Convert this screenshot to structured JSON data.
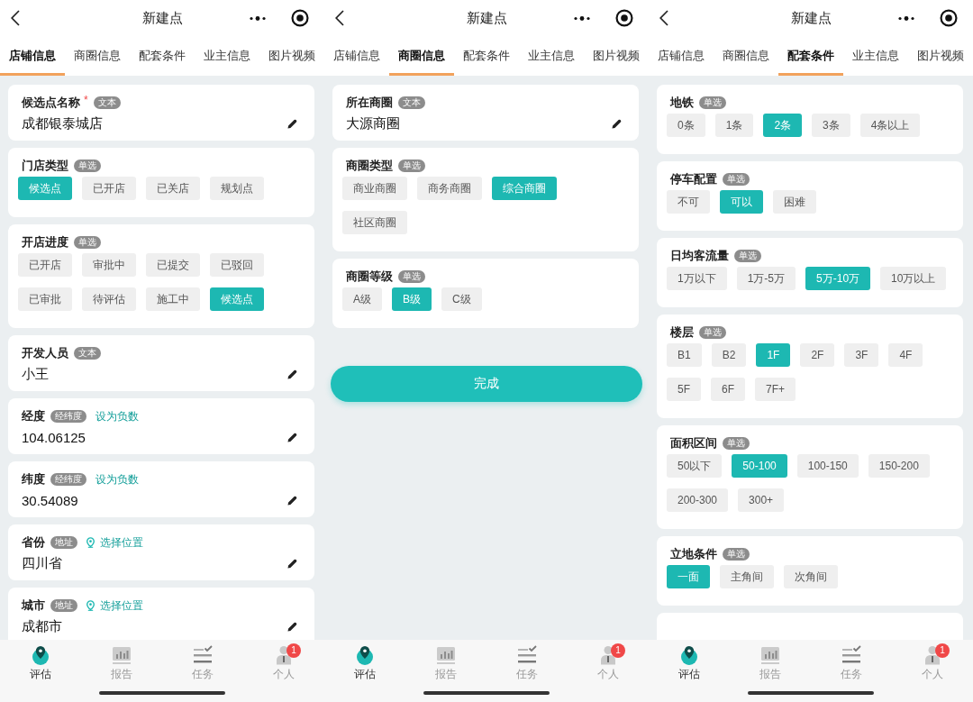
{
  "phones": [
    {
      "header": {
        "title": "新建点"
      },
      "tabs": [
        {
          "label": "店铺信息",
          "selected": true
        },
        {
          "label": "商圈信息",
          "selected": false
        },
        {
          "label": "配套条件",
          "selected": false
        },
        {
          "label": "业主信息",
          "selected": false
        },
        {
          "label": "图片视频",
          "selected": false
        }
      ],
      "sections": [
        {
          "kind": "text",
          "title": "候选点名称",
          "required_mark": "*",
          "tag": "文本",
          "value": "成都银泰城店"
        },
        {
          "kind": "choice",
          "title": "门店类型",
          "tag": "单选",
          "options": [
            {
              "label": "候选点",
              "selected": true
            },
            {
              "label": "已开店",
              "selected": false
            },
            {
              "label": "已关店",
              "selected": false
            },
            {
              "label": "规划点",
              "selected": false
            }
          ]
        },
        {
          "kind": "choice",
          "title": "开店进度",
          "tag": "单选",
          "options": [
            {
              "label": "已开店",
              "selected": false
            },
            {
              "label": "审批中",
              "selected": false
            },
            {
              "label": "已提交",
              "selected": false
            },
            {
              "label": "已驳回",
              "selected": false
            },
            {
              "label": "已审批",
              "selected": false
            },
            {
              "label": "待评估",
              "selected": false
            },
            {
              "label": "施工中",
              "selected": false
            },
            {
              "label": "候选点",
              "selected": true
            }
          ]
        },
        {
          "kind": "text",
          "title": "开发人员",
          "tag": "文本",
          "value": "小王"
        },
        {
          "kind": "text",
          "title": "经度",
          "tag": "经纬度",
          "link": {
            "kind": "action",
            "label": "设为负数"
          },
          "value": "104.06125"
        },
        {
          "kind": "text",
          "title": "纬度",
          "tag": "经纬度",
          "link": {
            "kind": "action",
            "label": "设为负数"
          },
          "value": "30.54089"
        },
        {
          "kind": "text",
          "title": "省份",
          "tag": "地址",
          "link": {
            "kind": "location",
            "label": "选择位置"
          },
          "value": "四川省"
        },
        {
          "kind": "text",
          "title": "城市",
          "tag": "地址",
          "link": {
            "kind": "location",
            "label": "选择位置"
          },
          "value": "成都市"
        }
      ],
      "bottom_nav": [
        {
          "label": "评估",
          "selected": true
        },
        {
          "label": "报告",
          "selected": false
        },
        {
          "label": "任务",
          "selected": false
        },
        {
          "label": "个人",
          "selected": false,
          "badge": "1"
        }
      ]
    },
    {
      "header": {
        "title": "新建点"
      },
      "tabs": [
        {
          "label": "店铺信息",
          "selected": false
        },
        {
          "label": "商圈信息",
          "selected": true
        },
        {
          "label": "配套条件",
          "selected": false
        },
        {
          "label": "业主信息",
          "selected": false
        },
        {
          "label": "图片视频",
          "selected": false
        }
      ],
      "sections": [
        {
          "kind": "text",
          "title": "所在商圈",
          "tag": "文本",
          "value": "大源商圈"
        },
        {
          "kind": "choice",
          "title": "商圈类型",
          "tag": "单选",
          "options": [
            {
              "label": "商业商圈",
              "selected": false
            },
            {
              "label": "商务商圈",
              "selected": false
            },
            {
              "label": "综合商圈",
              "selected": true
            },
            {
              "label": "社区商圈",
              "selected": false
            }
          ]
        },
        {
          "kind": "choice",
          "title": "商圈等级",
          "tag": "单选",
          "options": [
            {
              "label": "A级",
              "selected": false
            },
            {
              "label": "B级",
              "selected": true
            },
            {
              "label": "C级",
              "selected": false
            }
          ]
        }
      ],
      "submit_button": {
        "label": "完成"
      },
      "bottom_nav": [
        {
          "label": "评估",
          "selected": true
        },
        {
          "label": "报告",
          "selected": false
        },
        {
          "label": "任务",
          "selected": false
        },
        {
          "label": "个人",
          "selected": false,
          "badge": "1"
        }
      ]
    },
    {
      "header": {
        "title": "新建点"
      },
      "tabs": [
        {
          "label": "店铺信息",
          "selected": false
        },
        {
          "label": "商圈信息",
          "selected": false
        },
        {
          "label": "配套条件",
          "selected": true
        },
        {
          "label": "业主信息",
          "selected": false
        },
        {
          "label": "图片视频",
          "selected": false
        }
      ],
      "sections": [
        {
          "kind": "choice",
          "title": "地铁",
          "tag": "单选",
          "options": [
            {
              "label": "0条",
              "selected": false
            },
            {
              "label": "1条",
              "selected": false
            },
            {
              "label": "2条",
              "selected": true
            },
            {
              "label": "3条",
              "selected": false
            },
            {
              "label": "4条以上",
              "selected": false
            }
          ]
        },
        {
          "kind": "choice",
          "title": "停车配置",
          "tag": "单选",
          "options": [
            {
              "label": "不可",
              "selected": false
            },
            {
              "label": "可以",
              "selected": true
            },
            {
              "label": "困难",
              "selected": false
            }
          ]
        },
        {
          "kind": "choice",
          "title": "日均客流量",
          "tag": "单选",
          "options": [
            {
              "label": "1万以下",
              "selected": false
            },
            {
              "label": "1万-5万",
              "selected": false
            },
            {
              "label": "5万-10万",
              "selected": true
            },
            {
              "label": "10万以上",
              "selected": false
            }
          ]
        },
        {
          "kind": "choice",
          "title": "楼层",
          "tag": "单选",
          "options": [
            {
              "label": "B1",
              "selected": false
            },
            {
              "label": "B2",
              "selected": false
            },
            {
              "label": "1F",
              "selected": true
            },
            {
              "label": "2F",
              "selected": false
            },
            {
              "label": "3F",
              "selected": false
            },
            {
              "label": "4F",
              "selected": false
            },
            {
              "label": "5F",
              "selected": false
            },
            {
              "label": "6F",
              "selected": false
            },
            {
              "label": "7F+",
              "selected": false
            }
          ]
        },
        {
          "kind": "choice",
          "title": "面积区间",
          "tag": "单选",
          "options": [
            {
              "label": "50以下",
              "selected": false
            },
            {
              "label": "50-100",
              "selected": true
            },
            {
              "label": "100-150",
              "selected": false
            },
            {
              "label": "150-200",
              "selected": false
            },
            {
              "label": "200-300",
              "selected": false
            },
            {
              "label": "300+",
              "selected": false
            }
          ]
        },
        {
          "kind": "choice",
          "title": "立地条件",
          "tag": "单选",
          "options": [
            {
              "label": "一面",
              "selected": true
            },
            {
              "label": "主角间",
              "selected": false
            },
            {
              "label": "次角间",
              "selected": false
            }
          ]
        },
        {
          "kind": "clipped"
        }
      ],
      "bottom_nav": [
        {
          "label": "评估",
          "selected": true
        },
        {
          "label": "报告",
          "selected": false
        },
        {
          "label": "任务",
          "selected": false
        },
        {
          "label": "个人",
          "selected": false,
          "badge": "1"
        }
      ]
    }
  ]
}
